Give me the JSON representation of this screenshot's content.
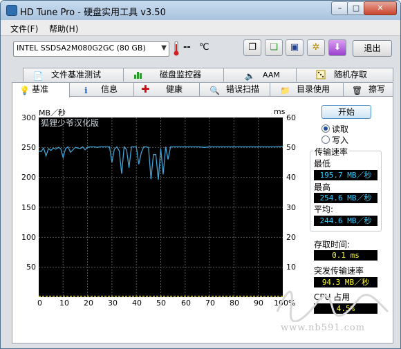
{
  "window": {
    "title": "HD Tune Pro - 硬盘实用工具 v3.50"
  },
  "menu": [
    "文件(F)",
    "帮助(H)"
  ],
  "toolbar": {
    "drive": "INTEL SSDSA2M080G2GC (80 GB)",
    "temperature": "--",
    "temp_unit": "℃",
    "exit_label": "退出"
  },
  "tabs_top": [
    {
      "label": "文件基准测试",
      "icon": "file-benchmark-icon"
    },
    {
      "label": "磁盘监控器",
      "icon": "disk-monitor-icon"
    },
    {
      "label": "AAM",
      "icon": "speaker-icon"
    },
    {
      "label": "随机存取",
      "icon": "random-access-icon"
    }
  ],
  "tabs_bottom": [
    {
      "label": "基准",
      "icon": "bulb-icon",
      "active": true
    },
    {
      "label": "信息",
      "icon": "info-icon"
    },
    {
      "label": "健康",
      "icon": "health-cross-icon"
    },
    {
      "label": "错误扫描",
      "icon": "magnifier-icon"
    },
    {
      "label": "目录使用",
      "icon": "folder-icon"
    },
    {
      "label": "擦写",
      "icon": "trash-icon"
    }
  ],
  "graph": {
    "left_unit": "MB／秒",
    "right_unit": "ms",
    "overlay_text": "狐狸少爷汉化版",
    "y_left_ticks": [
      "300",
      "250",
      "200",
      "150",
      "100",
      "50"
    ],
    "y_right_ticks": [
      "60",
      "50",
      "40",
      "30",
      "20",
      "10"
    ],
    "x_ticks": [
      "0",
      "10",
      "20",
      "30",
      "40",
      "50",
      "60",
      "70",
      "80",
      "90",
      "100%"
    ]
  },
  "chart_data": {
    "type": "line",
    "ylim": [
      0,
      300
    ],
    "xlim": [
      0,
      100
    ],
    "y2lim": [
      0,
      60
    ],
    "x_unit": "%",
    "series": [
      {
        "color": "#3fa3d8",
        "x": [
          0,
          1,
          2,
          3,
          4,
          5,
          6,
          7,
          8,
          9,
          10,
          11,
          12,
          13,
          14,
          15,
          16,
          17,
          18,
          19,
          20,
          21,
          22,
          23,
          24,
          25,
          26,
          27,
          28,
          29,
          30,
          31,
          32,
          33,
          34,
          35,
          36,
          37,
          38,
          39,
          40,
          41,
          42,
          43,
          44,
          45,
          46,
          47,
          48,
          49,
          50,
          51,
          52,
          53,
          54,
          55,
          56,
          57,
          58,
          59,
          60,
          62,
          64,
          66,
          68,
          70,
          72,
          74,
          76,
          78,
          80,
          82,
          84,
          86,
          88,
          90,
          92,
          94,
          96,
          98,
          100
        ],
        "y": [
          244,
          243,
          249,
          236,
          248,
          245,
          249,
          247,
          250,
          248,
          233,
          248,
          251,
          242,
          246,
          250,
          249,
          248,
          251,
          246,
          250,
          251,
          251,
          251,
          250,
          251,
          251,
          251,
          251,
          251,
          225,
          247,
          251,
          244,
          206,
          251,
          246,
          216,
          251,
          251,
          251,
          222,
          241,
          251,
          251,
          250,
          197,
          238,
          238,
          196,
          248,
          205,
          251,
          230,
          251,
          251,
          251,
          251,
          251,
          251,
          251,
          251,
          251,
          251,
          250,
          251,
          251,
          251,
          251,
          251,
          251,
          251,
          251,
          251,
          251,
          251,
          251,
          251,
          251,
          251,
          252
        ]
      },
      {
        "color": "#e8e84a",
        "x": [
          0,
          10,
          20,
          30,
          40,
          50,
          60,
          70,
          80,
          90,
          100
        ],
        "y2": [
          0.1,
          0.1,
          0.1,
          0.1,
          0.1,
          0.1,
          0.1,
          0.1,
          0.1,
          0.1,
          0.1
        ]
      }
    ]
  },
  "side": {
    "start_label": "开始",
    "read_label": "读取",
    "write_label": "写入",
    "mode": "read",
    "transfer_title": "传输速率",
    "min_label": "最低",
    "min_value": "195.7 MB／秒",
    "max_label": "最高",
    "max_value": "254.6 MB／秒",
    "avg_label": "平均:",
    "avg_value": "244.6 MB／秒",
    "access_label": "存取时间:",
    "access_value": "0.1 ms",
    "burst_label": "突发传输速率",
    "burst_value": "94.3 MB／秒",
    "cpu_label": "CPU 占用",
    "cpu_value": "4.5%"
  },
  "watermark": {
    "site": "www.nb591.com"
  }
}
